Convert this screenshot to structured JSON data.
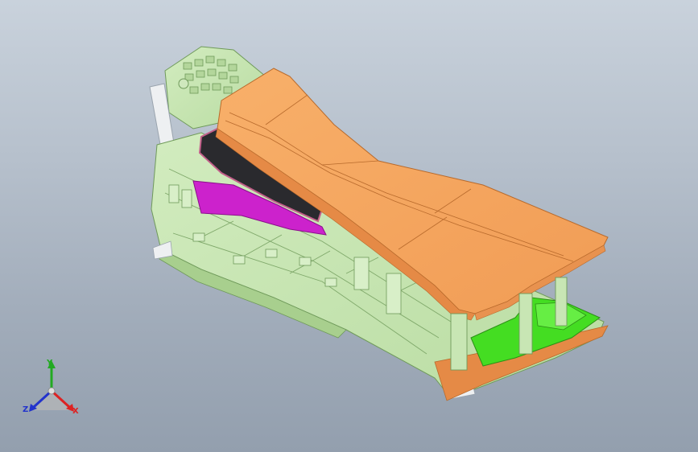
{
  "viewport": {
    "background_top": "#c9d2dc",
    "background_bottom": "#939fae"
  },
  "model": {
    "colors": {
      "lid": "#f6a863",
      "lid_shadow": "#e58a46",
      "frame": "#c8e6b4",
      "frame_dark": "#7fa86a",
      "pocket_magenta": "#cc22cc",
      "pocket_green": "#44dd22",
      "trim_white": "#eef0f2"
    }
  },
  "triad": {
    "x_label": "X",
    "y_label": "Y",
    "z_label": "Z",
    "x_color": "#dd2222",
    "y_color": "#22aa22",
    "z_color": "#2233cc"
  }
}
